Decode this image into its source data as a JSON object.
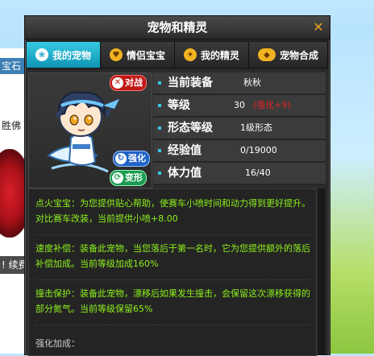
{
  "background": {
    "tag1": "宝石",
    "tag2": "胜佛",
    "tag3": "! 续费"
  },
  "window": {
    "title": "宠物和精灵",
    "close_icon": "close-x"
  },
  "tabs": [
    {
      "label": "我的宠物",
      "icon": "paw-icon",
      "active": true
    },
    {
      "label": "情侣宝宝",
      "icon": "lovers-icon",
      "active": false
    },
    {
      "label": "我的精灵",
      "icon": "spirit-icon",
      "active": false
    },
    {
      "label": "宠物合成",
      "icon": "merge-icon",
      "active": false
    }
  ],
  "pet": {
    "battle_label": "对战",
    "strengthen_label": "强化",
    "transform_label": "变形"
  },
  "stats": [
    {
      "label": "当前装备",
      "value": "秋秋",
      "extra": ""
    },
    {
      "label": "等级",
      "value": "30",
      "extra": "(强化+9)"
    },
    {
      "label": "形态等级",
      "value": "1级形态",
      "extra": ""
    },
    {
      "label": "经验值",
      "value": "0/19000",
      "extra": ""
    },
    {
      "label": "体力值",
      "value": "16/40",
      "extra": ""
    }
  ],
  "descriptions": [
    "点火宝宝：为您提供贴心帮助，使赛车小喷时间和动力得到更好提升。对比赛车改装，当前提供小喷+8.00",
    "速度补偿：装备此宠物，当您落后于第一名时，它为您提供额外的落后补偿加成。当前等级加成160%",
    "撞击保护：装备此宠物，漂移后如果发生撞击，会保留这次漂移获得的部分氮气。当前等级保留65%",
    "强化加成："
  ],
  "colors": {
    "accent": "#1aa3c4",
    "desc_text": "#8cf01c",
    "extra_red": "#e02424",
    "panel": "#2a2a2a"
  }
}
